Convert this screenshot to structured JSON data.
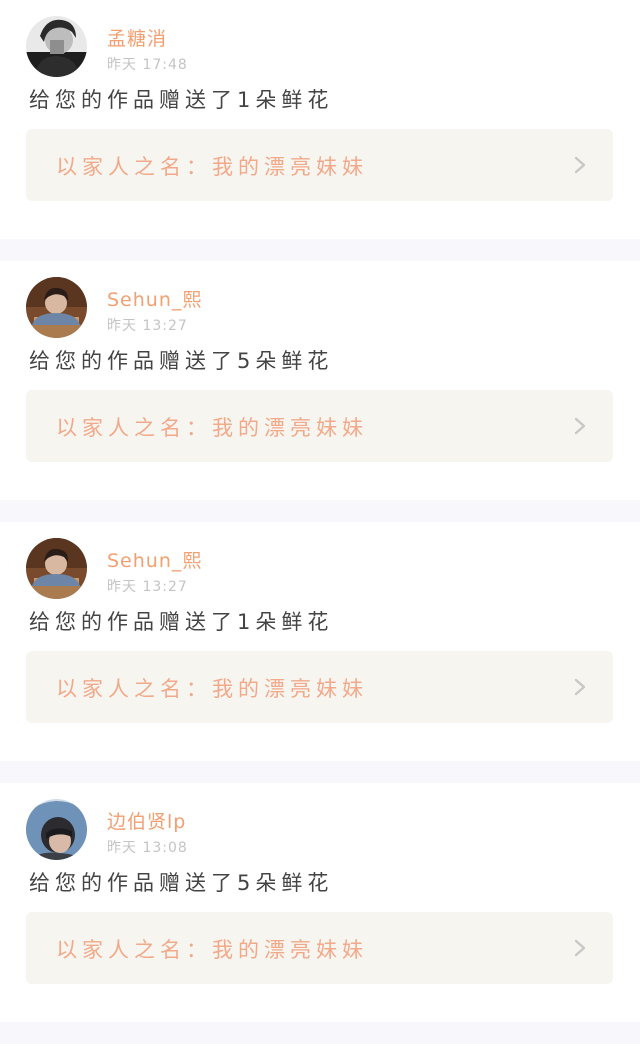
{
  "feed": {
    "items": [
      {
        "name": "孟糖消",
        "time": "昨天 17:48",
        "message": "给您的作品赠送了1朵鲜花",
        "link_text": "以家人之名：我的漂亮妹妹",
        "avatar_icon": "user-avatar"
      },
      {
        "name": "Sehun_熙",
        "time": "昨天 13:27",
        "message": "给您的作品赠送了5朵鲜花",
        "link_text": "以家人之名：我的漂亮妹妹",
        "avatar_icon": "user-avatar"
      },
      {
        "name": "Sehun_熙",
        "time": "昨天 13:27",
        "message": "给您的作品赠送了1朵鲜花",
        "link_text": "以家人之名：我的漂亮妹妹",
        "avatar_icon": "user-avatar"
      },
      {
        "name": "边伯贤lp",
        "time": "昨天 13:08",
        "message": "给您的作品赠送了5朵鲜花",
        "link_text": "以家人之名：我的漂亮妹妹",
        "avatar_icon": "user-avatar"
      }
    ]
  },
  "colors": {
    "name": "#f2a071",
    "time": "#c4c4c4",
    "message": "#444444",
    "link_text": "#f2a98a",
    "link_background": "#f6f5f0",
    "separator": "#f8f7fb",
    "chevron": "#c8c8c8"
  }
}
